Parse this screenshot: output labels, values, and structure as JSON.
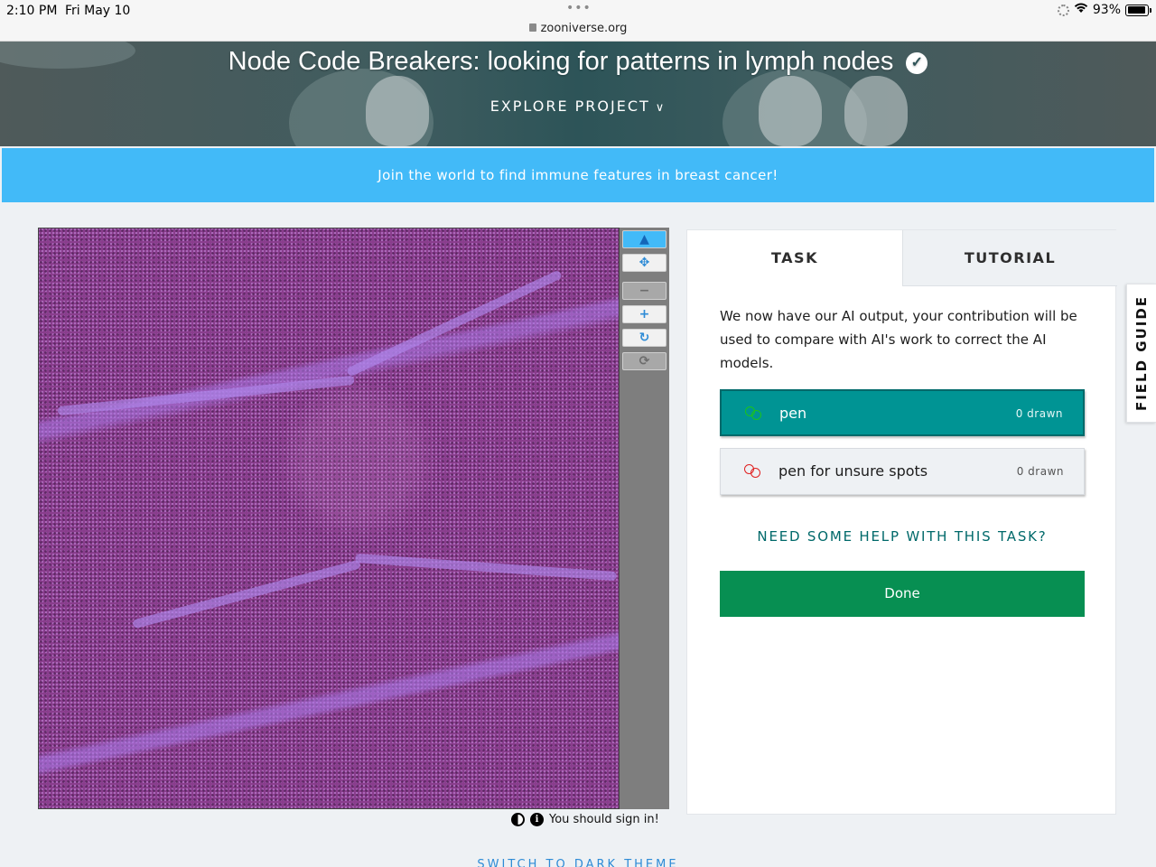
{
  "status_bar": {
    "time": "2:10 PM",
    "date": "Fri May 10",
    "url": "zooniverse.org",
    "battery": "93%",
    "battery_level": 0.93
  },
  "project": {
    "title": "Node Code Breakers: looking for patterns in lymph nodes",
    "verified_icon": "checkmark-circle-icon",
    "explore_label": "EXPLORE PROJECT"
  },
  "banner": {
    "text": "Join the world to find immune features in breast cancer!"
  },
  "viewer": {
    "tools": [
      {
        "name": "pointer-icon",
        "glyph": "▲",
        "state": "active"
      },
      {
        "name": "move-icon",
        "glyph": "✥",
        "state": "normal"
      },
      {
        "name": "zoom-out-icon",
        "glyph": "−",
        "state": "disabled"
      },
      {
        "name": "zoom-in-icon",
        "glyph": "+",
        "state": "normal"
      },
      {
        "name": "rotate-icon",
        "glyph": "↻",
        "state": "normal"
      },
      {
        "name": "reset-icon",
        "glyph": "⟳",
        "state": "disabled"
      }
    ],
    "sign_in_text": "You should sign in!"
  },
  "task_panel": {
    "tab_task": "TASK",
    "tab_tutorial": "TUTORIAL",
    "instruction": "We now have our AI output, your contribution will be used to compare with AI's work to correct the AI models.",
    "tools": [
      {
        "label": "pen",
        "count": "0 drawn",
        "color": "#1bc41b",
        "selected": true
      },
      {
        "label": "pen for unsure spots",
        "count": "0 drawn",
        "color": "#e02020",
        "selected": false
      }
    ],
    "help_link": "NEED SOME HELP WITH THIS TASK?",
    "done_button": "Done"
  },
  "field_guide": "FIELD GUIDE",
  "footer": {
    "dark_theme": "SWITCH TO DARK THEME"
  },
  "colors": {
    "banner": "#42baf8",
    "selected_tool": "#009494",
    "done": "#078f52",
    "link": "#00696a"
  }
}
